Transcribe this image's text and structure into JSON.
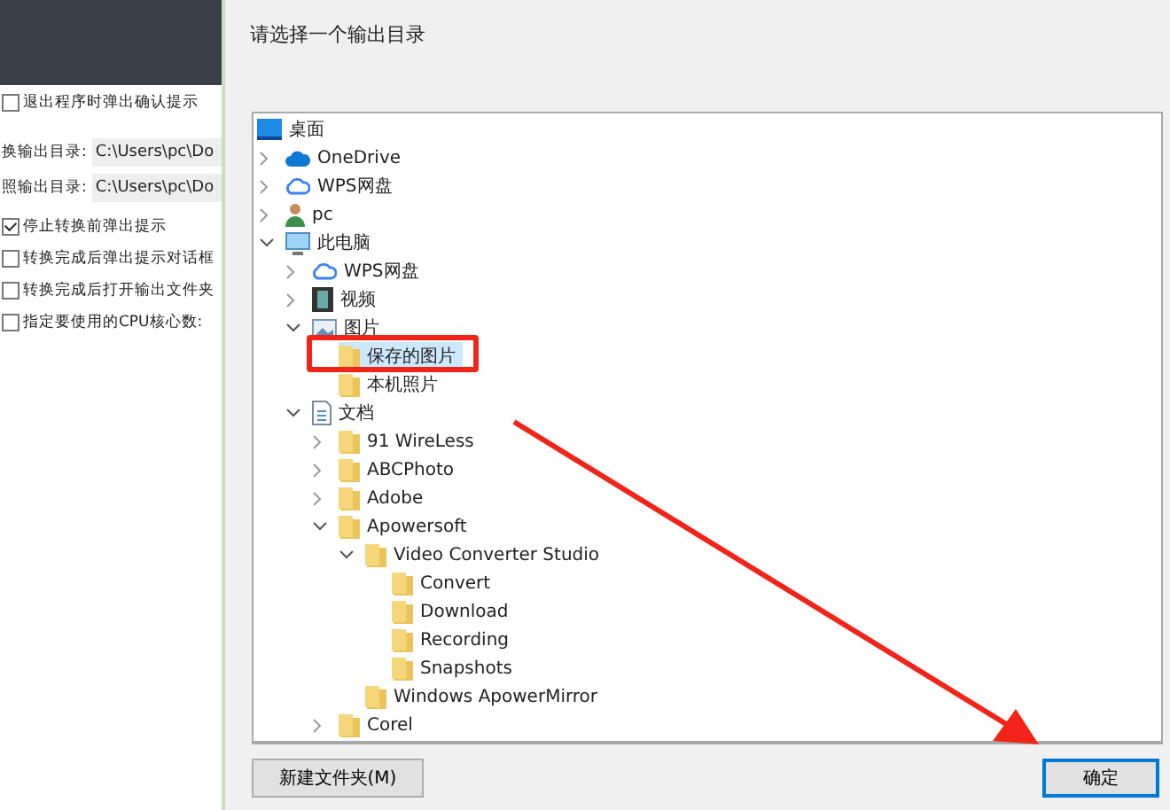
{
  "background_app": {
    "options_top": [
      {
        "label": "退出程序时弹出确认提示",
        "checked": false
      }
    ],
    "paths": [
      {
        "label": "换输出目录:",
        "value": "C:\\Users\\pc\\Do"
      },
      {
        "label": "照输出目录:",
        "value": "C:\\Users\\pc\\Do"
      }
    ],
    "options": [
      {
        "label": "停止转换前弹出提示",
        "checked": true
      },
      {
        "label": "转换完成后弹出提示对话框",
        "checked": false
      },
      {
        "label": "转换完成后打开输出文件夹",
        "checked": false
      },
      {
        "label": "指定要使用的CPU核心数:",
        "checked": false
      }
    ]
  },
  "dialog": {
    "title": "请选择一个输出目录",
    "tree": [
      {
        "label": "桌面",
        "kind": "desktop",
        "selected": false,
        "children": [
          {
            "label": "OneDrive",
            "kind": "onedrive",
            "expanded": false,
            "selected": false
          },
          {
            "label": "WPS网盘",
            "kind": "cloud",
            "expanded": false,
            "selected": false
          },
          {
            "label": "pc",
            "kind": "user",
            "expanded": false,
            "selected": false
          },
          {
            "label": "此电脑",
            "kind": "computer",
            "expanded": true,
            "selected": false,
            "children": [
              {
                "label": "WPS网盘",
                "kind": "cloud",
                "expanded": false,
                "selected": false
              },
              {
                "label": "视频",
                "kind": "video",
                "expanded": false,
                "selected": false
              },
              {
                "label": "图片",
                "kind": "pictures",
                "expanded": true,
                "selected": false,
                "children": [
                  {
                    "label": "保存的图片",
                    "kind": "folder",
                    "selected": true
                  },
                  {
                    "label": "本机照片",
                    "kind": "folder",
                    "selected": false
                  }
                ]
              },
              {
                "label": "文档",
                "kind": "documents",
                "expanded": true,
                "selected": false,
                "children": [
                  {
                    "label": "91 WireLess",
                    "kind": "folder",
                    "expanded": false,
                    "selected": false
                  },
                  {
                    "label": "ABCPhoto",
                    "kind": "folder",
                    "expanded": false,
                    "selected": false
                  },
                  {
                    "label": "Adobe",
                    "kind": "folder",
                    "expanded": false,
                    "selected": false
                  },
                  {
                    "label": "Apowersoft",
                    "kind": "folder",
                    "expanded": true,
                    "selected": false,
                    "children": [
                      {
                        "label": "Video Converter Studio",
                        "kind": "folder",
                        "expanded": true,
                        "selected": false,
                        "children": [
                          {
                            "label": "Convert",
                            "kind": "folder",
                            "selected": false
                          },
                          {
                            "label": "Download",
                            "kind": "folder",
                            "selected": false
                          },
                          {
                            "label": "Recording",
                            "kind": "folder",
                            "selected": false
                          },
                          {
                            "label": "Snapshots",
                            "kind": "folder",
                            "selected": false
                          }
                        ]
                      },
                      {
                        "label": "Windows ApowerMirror",
                        "kind": "folder",
                        "selected": false
                      }
                    ]
                  },
                  {
                    "label": "Corel",
                    "kind": "folder",
                    "expanded": false,
                    "selected": false
                  }
                ]
              }
            ]
          }
        ]
      }
    ],
    "buttons": [
      {
        "label": "新建文件夹(M)",
        "kind": "secondary"
      },
      {
        "label": "确定",
        "kind": "primary"
      }
    ]
  }
}
